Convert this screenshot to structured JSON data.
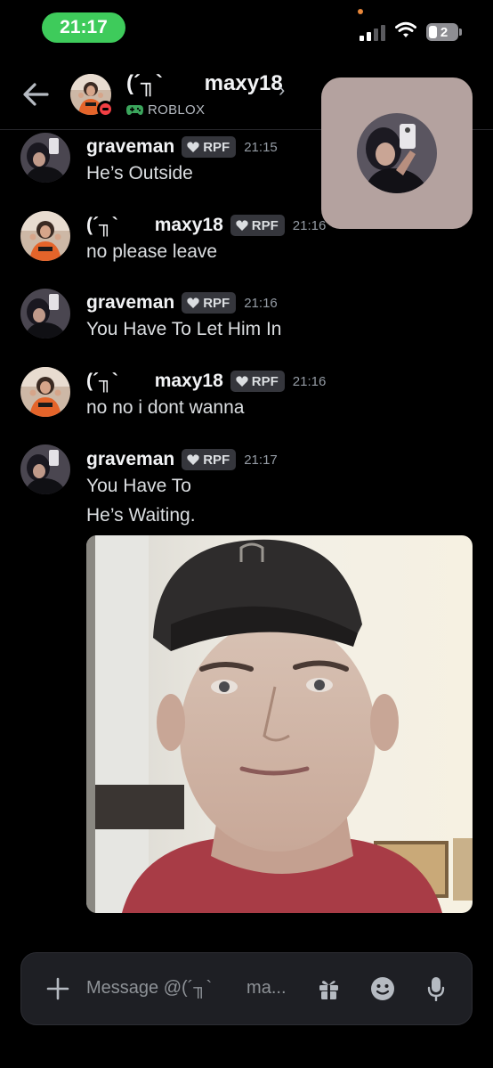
{
  "status_bar": {
    "time": "21:17",
    "battery_badge": "2"
  },
  "header": {
    "name": "(´╖`       maxy18",
    "activity": "ROBLOX",
    "chevron": "›"
  },
  "messages": [
    {
      "user": "graveman",
      "tag": "RPF",
      "time": "21:15",
      "lines": [
        "He’s Outside"
      ]
    },
    {
      "user": "(´╖`       maxy18",
      "tag": "RPF",
      "time": "21:16",
      "lines": [
        "no please leave"
      ]
    },
    {
      "user": "graveman",
      "tag": "RPF",
      "time": "21:16",
      "lines": [
        "You Have To Let Him In"
      ]
    },
    {
      "user": "(´╖`       maxy18",
      "tag": "RPF",
      "time": "21:16",
      "lines": [
        "no no i dont wanna"
      ]
    },
    {
      "user": "graveman",
      "tag": "RPF",
      "time": "21:17",
      "lines": [
        "You Have To",
        "He’s Waiting."
      ]
    }
  ],
  "composer": {
    "placeholder": "Message @(´╖`       ma..."
  },
  "icons": {
    "back": "back-arrow-icon",
    "activity": "gamepad-icon",
    "tag": "heart-icon",
    "composer_left": "plus-icon",
    "composer_right": [
      "gift-icon",
      "emoji-icon",
      "microphone-icon"
    ]
  },
  "colors": {
    "background": "#000000",
    "status_pill": "#3ecb5b",
    "dnd": "#f23f43",
    "activity_green": "#3ba55c",
    "tag_bg": "#35363c",
    "pip_bg": "#b4a29f"
  }
}
